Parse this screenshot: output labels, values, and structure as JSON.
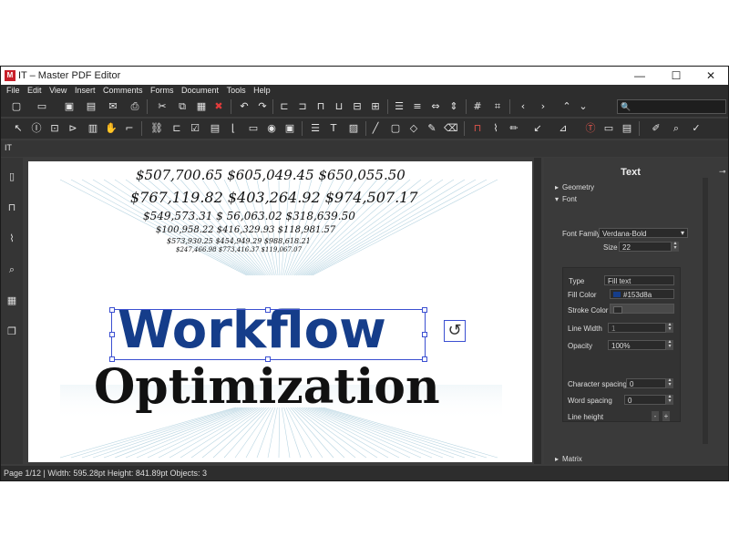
{
  "window": {
    "title": "IT – Master PDF Editor",
    "app_icon_text": "M",
    "controls": {
      "minimize": "—",
      "maximize": "☐",
      "close": "✕"
    }
  },
  "menu": [
    "File",
    "Edit",
    "View",
    "Insert",
    "Comments",
    "Forms",
    "Document",
    "Tools",
    "Help"
  ],
  "search": {
    "icon": "🔍",
    "value": ""
  },
  "doc_tab": "IT",
  "document": {
    "money_rows": [
      "$507,700.65   $605,049.45   $650,055.50",
      "$767,119.82   $403,264.92   $974,507.17",
      "$549,573.31   $ 56,063.02   $318,639.50",
      "$100,958.22   $416,329.93   $118,981.57",
      "$573,930.25   $454,949.29   $988,618.21",
      "$247,466.98   $773,416.37   $119,067.07"
    ],
    "headline": "Workflow",
    "subheadline": "Optimization"
  },
  "panel": {
    "title": "Text",
    "sections": {
      "geometry": "Geometry",
      "font": "Font",
      "matrix": "Matrix"
    },
    "font_family_label": "Font Family",
    "font_family_value": "Verdana-Bold",
    "size_label": "Size",
    "size_value": "22",
    "type_label": "Type",
    "type_value": "Fill text",
    "fill_color_label": "Fill Color",
    "fill_color_value": "#153d8a",
    "stroke_color_label": "Stroke Color",
    "line_width_label": "Line Width",
    "line_width_value": "1",
    "opacity_label": "Opacity",
    "opacity_value": "100%",
    "char_spacing_label": "Character spacing",
    "char_spacing_value": "0",
    "word_spacing_label": "Word spacing",
    "word_spacing_value": "0",
    "line_height_label": "Line height",
    "line_height_minus": "-",
    "line_height_plus": "+"
  },
  "status": "Page 1/12 | Width: 595.28pt Height: 841.89pt Objects: 3",
  "colors": {
    "headline": "#153d8a",
    "selection": "#3b4fd1",
    "chrome": "#2d2d2d"
  }
}
